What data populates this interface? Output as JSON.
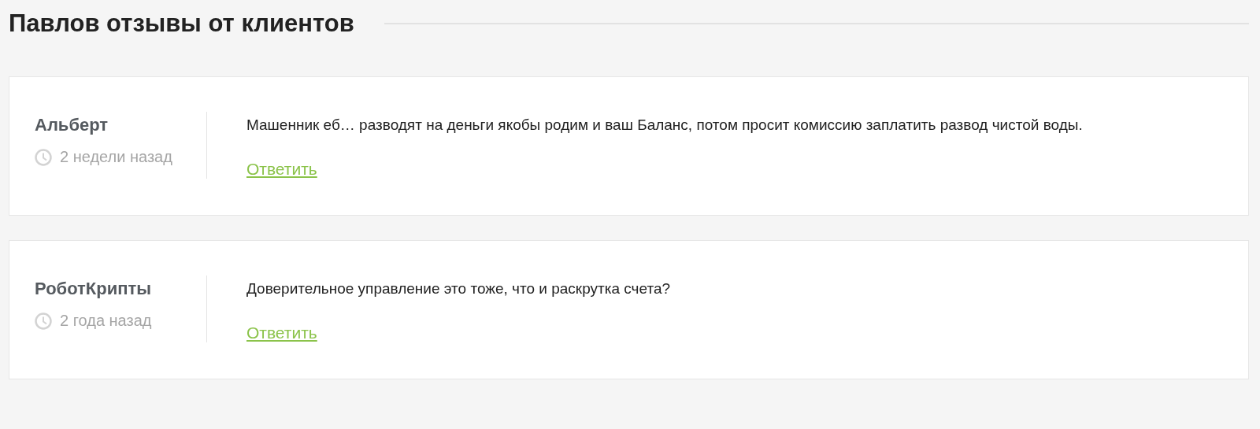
{
  "heading": "Павлов отзывы от клиентов",
  "reviews": [
    {
      "author": "Альберт",
      "time": "2 недели назад",
      "text": "Машенник еб… разводят на деньги якобы родим и ваш Баланс, потом просит комиссию заплатить развод чистой воды.",
      "reply": "Ответить"
    },
    {
      "author": "РоботКрипты",
      "time": "2 года назад",
      "text": "Доверительное управление это тоже, что и раскрутка счета?",
      "reply": "Ответить"
    }
  ]
}
